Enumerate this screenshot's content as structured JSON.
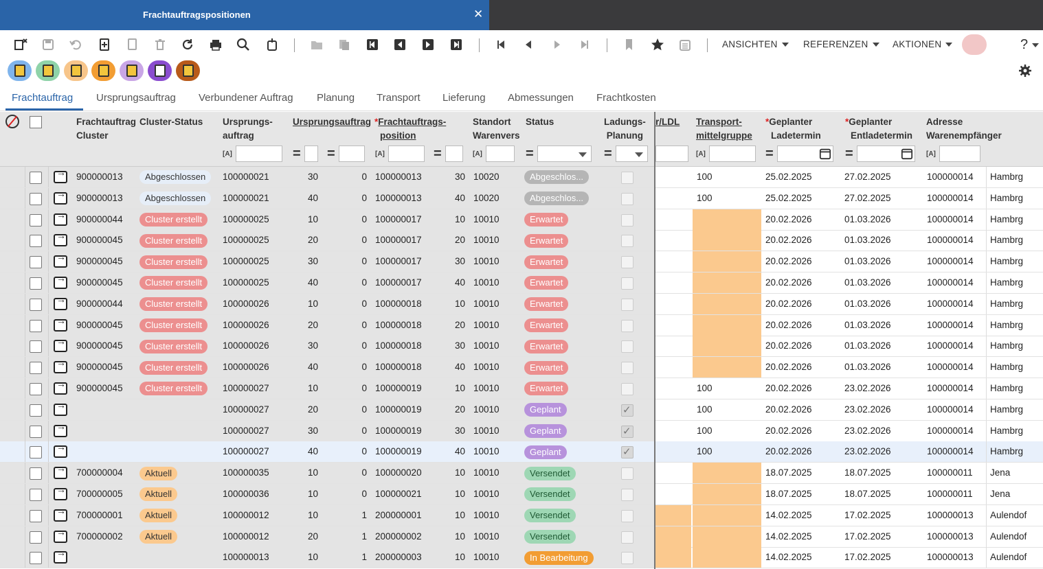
{
  "window": {
    "tab_title": "Frachtauftragspositionen",
    "close_glyph": "✕"
  },
  "toolbar": {
    "menus": [
      "ANSICHTEN",
      "REFERENZEN",
      "AKTIONEN"
    ],
    "help": "?"
  },
  "nav_tabs": [
    "Frachtauftrag",
    "Ursprungsauftrag",
    "Verbundener Auftrag",
    "Planung",
    "Transport",
    "Lieferung",
    "Abmessungen",
    "Frachtkosten"
  ],
  "headers": {
    "fa_cluster": [
      "Frachtauftrag",
      "Cluster"
    ],
    "cluster_status": [
      "Cluster-Status"
    ],
    "ursprungsauftrag1": [
      "Ursprungs-",
      "auftrag"
    ],
    "ursprungsauftrag2": [
      "Ursprungsauftrag"
    ],
    "fa_position": [
      "Frachtauftrags-",
      "position"
    ],
    "standort": [
      "Standort",
      "Warenvers"
    ],
    "status": [
      "Status"
    ],
    "ladungsplanung": [
      "Ladungs-",
      "Planung"
    ],
    "ldl": [
      "r/LDL"
    ],
    "transport": [
      "Transport-",
      "mittelgruppe"
    ],
    "ladetermin": [
      "Geplanter",
      "Ladetermin"
    ],
    "entladetermin": [
      "Geplanter",
      "Entladetermin"
    ],
    "adresse": [
      "Adresse",
      "Warenempfänger"
    ]
  },
  "filter_glyphs": {
    "text": "[A]",
    "eq": "="
  },
  "status_colors": {
    "Abgeschlossen": "#b5b5b5",
    "Erwartet": "#ec8f8f",
    "Geplant": "#b792dc",
    "Versendet": "#9ed7b4",
    "In Bearbeitung": "#f29d33",
    "cluster_Abgeschlossen": "#e6eef8",
    "cluster_Cluster erstellt": "#ec8f8f",
    "cluster_Aktuell": "#fbc98e"
  },
  "rows": [
    {
      "cluster": "900000013",
      "cstatus": "Abgeschlossen",
      "ua": "100000021",
      "ua_pos": "30",
      "ua2": "0",
      "fap": "100000013",
      "fap_pos": "30",
      "standort": "10020",
      "status": "Abgeschlos...",
      "status_key": "Abgeschlossen",
      "lp": false,
      "tmg": "100",
      "lade": "25.02.2025",
      "entlade": "27.02.2025",
      "adr": "100000014",
      "ort": "Hambrg",
      "orange_tmg": false,
      "orange_ldl": false
    },
    {
      "cluster": "900000013",
      "cstatus": "Abgeschlossen",
      "ua": "100000021",
      "ua_pos": "40",
      "ua2": "0",
      "fap": "100000013",
      "fap_pos": "40",
      "standort": "10020",
      "status": "Abgeschlos...",
      "status_key": "Abgeschlossen",
      "lp": false,
      "tmg": "100",
      "lade": "25.02.2025",
      "entlade": "27.02.2025",
      "adr": "100000014",
      "ort": "Hambrg",
      "orange_tmg": false,
      "orange_ldl": false
    },
    {
      "cluster": "900000044",
      "cstatus": "Cluster erstellt",
      "ua": "100000025",
      "ua_pos": "10",
      "ua2": "0",
      "fap": "100000017",
      "fap_pos": "10",
      "standort": "10010",
      "status": "Erwartet",
      "status_key": "Erwartet",
      "lp": false,
      "tmg": "",
      "lade": "20.02.2026",
      "entlade": "01.03.2026",
      "adr": "100000014",
      "ort": "Hambrg",
      "orange_tmg": true,
      "orange_ldl": false
    },
    {
      "cluster": "900000045",
      "cstatus": "Cluster erstellt",
      "ua": "100000025",
      "ua_pos": "20",
      "ua2": "0",
      "fap": "100000017",
      "fap_pos": "20",
      "standort": "10010",
      "status": "Erwartet",
      "status_key": "Erwartet",
      "lp": false,
      "tmg": "",
      "lade": "20.02.2026",
      "entlade": "01.03.2026",
      "adr": "100000014",
      "ort": "Hambrg",
      "orange_tmg": true,
      "orange_ldl": false
    },
    {
      "cluster": "900000045",
      "cstatus": "Cluster erstellt",
      "ua": "100000025",
      "ua_pos": "30",
      "ua2": "0",
      "fap": "100000017",
      "fap_pos": "30",
      "standort": "10010",
      "status": "Erwartet",
      "status_key": "Erwartet",
      "lp": false,
      "tmg": "",
      "lade": "20.02.2026",
      "entlade": "01.03.2026",
      "adr": "100000014",
      "ort": "Hambrg",
      "orange_tmg": true,
      "orange_ldl": false
    },
    {
      "cluster": "900000045",
      "cstatus": "Cluster erstellt",
      "ua": "100000025",
      "ua_pos": "40",
      "ua2": "0",
      "fap": "100000017",
      "fap_pos": "40",
      "standort": "10010",
      "status": "Erwartet",
      "status_key": "Erwartet",
      "lp": false,
      "tmg": "",
      "lade": "20.02.2026",
      "entlade": "01.03.2026",
      "adr": "100000014",
      "ort": "Hambrg",
      "orange_tmg": true,
      "orange_ldl": false
    },
    {
      "cluster": "900000044",
      "cstatus": "Cluster erstellt",
      "ua": "100000026",
      "ua_pos": "10",
      "ua2": "0",
      "fap": "100000018",
      "fap_pos": "10",
      "standort": "10010",
      "status": "Erwartet",
      "status_key": "Erwartet",
      "lp": false,
      "tmg": "",
      "lade": "20.02.2026",
      "entlade": "01.03.2026",
      "adr": "100000014",
      "ort": "Hambrg",
      "orange_tmg": true,
      "orange_ldl": false
    },
    {
      "cluster": "900000045",
      "cstatus": "Cluster erstellt",
      "ua": "100000026",
      "ua_pos": "20",
      "ua2": "0",
      "fap": "100000018",
      "fap_pos": "20",
      "standort": "10010",
      "status": "Erwartet",
      "status_key": "Erwartet",
      "lp": false,
      "tmg": "",
      "lade": "20.02.2026",
      "entlade": "01.03.2026",
      "adr": "100000014",
      "ort": "Hambrg",
      "orange_tmg": true,
      "orange_ldl": false
    },
    {
      "cluster": "900000045",
      "cstatus": "Cluster erstellt",
      "ua": "100000026",
      "ua_pos": "30",
      "ua2": "0",
      "fap": "100000018",
      "fap_pos": "30",
      "standort": "10010",
      "status": "Erwartet",
      "status_key": "Erwartet",
      "lp": false,
      "tmg": "",
      "lade": "20.02.2026",
      "entlade": "01.03.2026",
      "adr": "100000014",
      "ort": "Hambrg",
      "orange_tmg": true,
      "orange_ldl": false
    },
    {
      "cluster": "900000045",
      "cstatus": "Cluster erstellt",
      "ua": "100000026",
      "ua_pos": "40",
      "ua2": "0",
      "fap": "100000018",
      "fap_pos": "40",
      "standort": "10010",
      "status": "Erwartet",
      "status_key": "Erwartet",
      "lp": false,
      "tmg": "",
      "lade": "20.02.2026",
      "entlade": "01.03.2026",
      "adr": "100000014",
      "ort": "Hambrg",
      "orange_tmg": true,
      "orange_ldl": false
    },
    {
      "cluster": "900000045",
      "cstatus": "Cluster erstellt",
      "ua": "100000027",
      "ua_pos": "10",
      "ua2": "0",
      "fap": "100000019",
      "fap_pos": "10",
      "standort": "10010",
      "status": "Erwartet",
      "status_key": "Erwartet",
      "lp": false,
      "tmg": "100",
      "lade": "20.02.2026",
      "entlade": "23.02.2026",
      "adr": "100000014",
      "ort": "Hambrg",
      "orange_tmg": false,
      "orange_ldl": false
    },
    {
      "cluster": "",
      "cstatus": "",
      "ua": "100000027",
      "ua_pos": "20",
      "ua2": "0",
      "fap": "100000019",
      "fap_pos": "20",
      "standort": "10010",
      "status": "Geplant",
      "status_key": "Geplant",
      "lp": true,
      "tmg": "100",
      "lade": "20.02.2026",
      "entlade": "23.02.2026",
      "adr": "100000014",
      "ort": "Hambrg",
      "orange_tmg": false,
      "orange_ldl": false
    },
    {
      "cluster": "",
      "cstatus": "",
      "ua": "100000027",
      "ua_pos": "30",
      "ua2": "0",
      "fap": "100000019",
      "fap_pos": "30",
      "standort": "10010",
      "status": "Geplant",
      "status_key": "Geplant",
      "lp": true,
      "tmg": "100",
      "lade": "20.02.2026",
      "entlade": "23.02.2026",
      "adr": "100000014",
      "ort": "Hambrg",
      "orange_tmg": false,
      "orange_ldl": false
    },
    {
      "cluster": "",
      "cstatus": "",
      "ua": "100000027",
      "ua_pos": "40",
      "ua2": "0",
      "fap": "100000019",
      "fap_pos": "40",
      "standort": "10010",
      "status": "Geplant",
      "status_key": "Geplant",
      "lp": true,
      "tmg": "100",
      "lade": "20.02.2026",
      "entlade": "23.02.2026",
      "adr": "100000014",
      "ort": "Hambrg",
      "orange_tmg": false,
      "orange_ldl": false,
      "selected": true
    },
    {
      "cluster": "700000004",
      "cstatus": "Aktuell",
      "ua": "100000035",
      "ua_pos": "10",
      "ua2": "0",
      "fap": "100000020",
      "fap_pos": "10",
      "standort": "10010",
      "status": "Versendet",
      "status_key": "Versendet",
      "lp": false,
      "tmg": "",
      "lade": "18.07.2025",
      "entlade": "18.07.2025",
      "adr": "100000011",
      "ort": "Jena",
      "orange_tmg": true,
      "orange_ldl": false
    },
    {
      "cluster": "700000005",
      "cstatus": "Aktuell",
      "ua": "100000036",
      "ua_pos": "10",
      "ua2": "0",
      "fap": "100000021",
      "fap_pos": "10",
      "standort": "10010",
      "status": "Versendet",
      "status_key": "Versendet",
      "lp": false,
      "tmg": "",
      "lade": "18.07.2025",
      "entlade": "18.07.2025",
      "adr": "100000011",
      "ort": "Jena",
      "orange_tmg": true,
      "orange_ldl": false
    },
    {
      "cluster": "700000001",
      "cstatus": "Aktuell",
      "ua": "100000012",
      "ua_pos": "10",
      "ua2": "1",
      "fap": "200000001",
      "fap_pos": "10",
      "standort": "10010",
      "status": "Versendet",
      "status_key": "Versendet",
      "lp": false,
      "tmg": "",
      "lade": "14.02.2025",
      "entlade": "17.02.2025",
      "adr": "100000013",
      "ort": "Aulendof",
      "orange_tmg": true,
      "orange_ldl": true
    },
    {
      "cluster": "700000002",
      "cstatus": "Aktuell",
      "ua": "100000012",
      "ua_pos": "20",
      "ua2": "1",
      "fap": "200000002",
      "fap_pos": "10",
      "standort": "10010",
      "status": "Versendet",
      "status_key": "Versendet",
      "lp": false,
      "tmg": "",
      "lade": "14.02.2025",
      "entlade": "17.02.2025",
      "adr": "100000013",
      "ort": "Aulendof",
      "orange_tmg": true,
      "orange_ldl": true
    },
    {
      "cluster": "",
      "cstatus": "",
      "ua": "100000013",
      "ua_pos": "10",
      "ua2": "1",
      "fap": "200000003",
      "fap_pos": "10",
      "standort": "10010",
      "status": "In Bearbeitung",
      "status_key": "In Bearbeitung",
      "lp": false,
      "tmg": "",
      "lade": "14.02.2025",
      "entlade": "17.02.2025",
      "adr": "100000013",
      "ort": "Aulendof",
      "orange_tmg": true,
      "orange_ldl": true
    }
  ]
}
